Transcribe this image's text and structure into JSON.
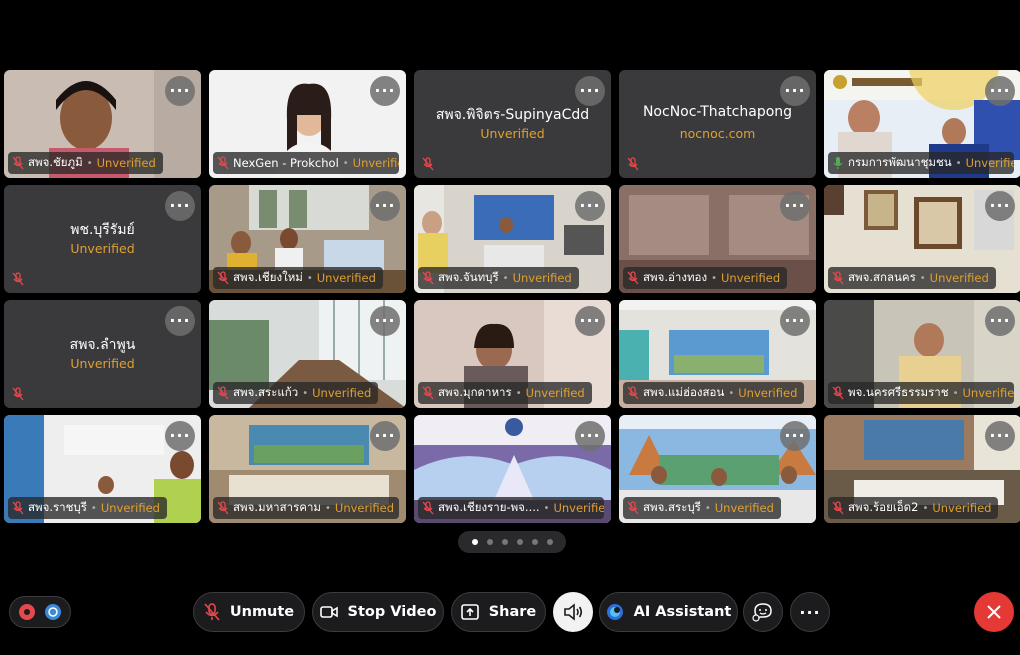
{
  "status_label": "Unverified",
  "tiles": [
    {
      "name": "สพจ.ชัยภูมิ",
      "video": true
    },
    {
      "name": "NexGen - Prokchol",
      "video": true
    },
    {
      "name": "สพจ.พิจิตร-SupinyaCdd",
      "video": false,
      "sub": "Unverified"
    },
    {
      "name": "NocNoc-Thatchapong",
      "video": false,
      "sub": "nocnoc.com"
    },
    {
      "name": "กรมการพัฒนาชุมชน",
      "video": true,
      "active": true
    },
    {
      "name": "พช.บุรีรัมย์",
      "video": false,
      "sub": "Unverified"
    },
    {
      "name": "สพจ.เชียงใหม่",
      "video": true
    },
    {
      "name": "สพจ.จันทบุรี",
      "video": true
    },
    {
      "name": "สพจ.อ่างทอง",
      "video": true
    },
    {
      "name": "สพจ.สกลนคร",
      "video": true
    },
    {
      "name": "สพจ.ลำพูน",
      "video": false,
      "sub": "Unverified"
    },
    {
      "name": "สพจ.สระแก้ว",
      "video": true
    },
    {
      "name": "สพจ.มุกดาหาร",
      "video": true
    },
    {
      "name": "สพจ.แม่ฮ่องสอน",
      "video": true
    },
    {
      "name": "พจ.นครศรีธรรมราช",
      "video": true
    },
    {
      "name": "สพจ.ราชบุรี",
      "video": true
    },
    {
      "name": "สพจ.มหาสารคาม",
      "video": true
    },
    {
      "name": "สพจ.เชียงราย-พจ....",
      "video": true
    },
    {
      "name": "สพจ.สระบุรี",
      "video": true
    },
    {
      "name": "สพจ.ร้อยเอ็ด2",
      "video": true
    }
  ],
  "pager": {
    "pages": 6,
    "current": 1
  },
  "toolbar": {
    "unmute_label": "Unmute",
    "stop_video_label": "Stop Video",
    "share_label": "Share",
    "ai_assistant_label": "AI Assistant"
  },
  "colors": {
    "unverified": "#e0a030",
    "end_call": "#e53935",
    "active_outline": "#6fb7d8"
  },
  "icons": [
    "more-icon",
    "mic-muted-icon",
    "mic-icon",
    "video-icon",
    "share-icon",
    "speaker-icon",
    "ai-assistant-icon",
    "reactions-icon",
    "close-icon"
  ]
}
